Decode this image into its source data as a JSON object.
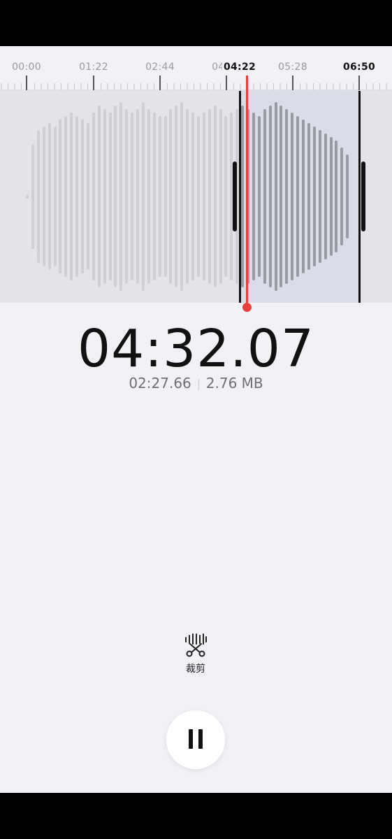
{
  "timeline": {
    "ticks": [
      "00:00",
      "01:22",
      "02:44",
      "04:06",
      "05:28",
      "06:50"
    ],
    "active_tick_label": "04:22"
  },
  "playback": {
    "current_time": "04:32.07",
    "duration": "02:27.66",
    "file_size": "2.76 MB"
  },
  "toolbar": {
    "trim_icon": "scissors-waveform-icon",
    "trim_label": "裁剪",
    "pause_icon": "pause-icon"
  },
  "colors": {
    "background": "#f1f1f6",
    "selection": "#d8dde8",
    "playhead": "#e8403a",
    "text_primary": "#111111",
    "text_secondary": "#6f6f76"
  }
}
